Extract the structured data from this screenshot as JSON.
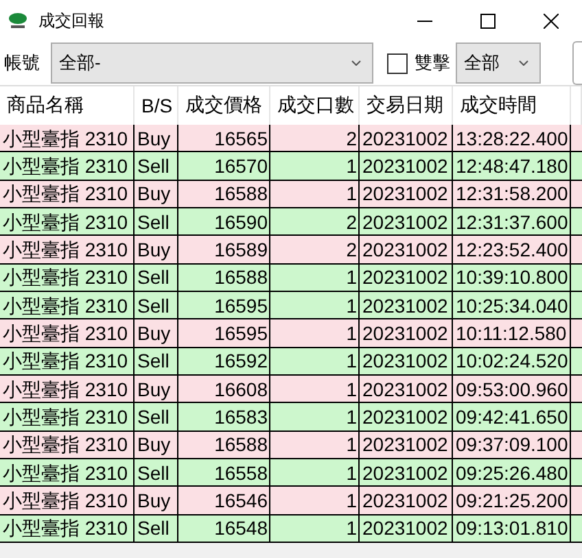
{
  "window": {
    "title": "成交回報"
  },
  "toolbar": {
    "account_label": "帳號",
    "account_value": "全部-",
    "double_click": {
      "label": "雙擊",
      "checked": false
    },
    "filter_value": "全部"
  },
  "table": {
    "columns": [
      "商品名稱",
      "B/S",
      "成交價格",
      "成交口數",
      "交易日期",
      "成交時間"
    ],
    "rows": [
      {
        "kind": "buy",
        "cells": [
          "小型臺指 2310",
          "Buy",
          "16565",
          "2",
          "20231002",
          "13:28:22.400"
        ]
      },
      {
        "kind": "sell",
        "cells": [
          "小型臺指 2310",
          "Sell",
          "16570",
          "1",
          "20231002",
          "12:48:47.180"
        ]
      },
      {
        "kind": "buy",
        "cells": [
          "小型臺指 2310",
          "Buy",
          "16588",
          "1",
          "20231002",
          "12:31:58.200"
        ]
      },
      {
        "kind": "sell",
        "cells": [
          "小型臺指 2310",
          "Sell",
          "16590",
          "2",
          "20231002",
          "12:31:37.600"
        ]
      },
      {
        "kind": "buy",
        "cells": [
          "小型臺指 2310",
          "Buy",
          "16589",
          "2",
          "20231002",
          "12:23:52.400"
        ]
      },
      {
        "kind": "sell",
        "cells": [
          "小型臺指 2310",
          "Sell",
          "16588",
          "1",
          "20231002",
          "10:39:10.800"
        ]
      },
      {
        "kind": "sell",
        "cells": [
          "小型臺指 2310",
          "Sell",
          "16595",
          "1",
          "20231002",
          "10:25:34.040"
        ]
      },
      {
        "kind": "buy",
        "cells": [
          "小型臺指 2310",
          "Buy",
          "16595",
          "1",
          "20231002",
          "10:11:12.580"
        ]
      },
      {
        "kind": "sell",
        "cells": [
          "小型臺指 2310",
          "Sell",
          "16592",
          "1",
          "20231002",
          "10:02:24.520"
        ]
      },
      {
        "kind": "buy",
        "cells": [
          "小型臺指 2310",
          "Buy",
          "16608",
          "1",
          "20231002",
          "09:53:00.960"
        ]
      },
      {
        "kind": "sell",
        "cells": [
          "小型臺指 2310",
          "Sell",
          "16583",
          "1",
          "20231002",
          "09:42:41.650"
        ]
      },
      {
        "kind": "buy",
        "cells": [
          "小型臺指 2310",
          "Buy",
          "16588",
          "1",
          "20231002",
          "09:37:09.100"
        ]
      },
      {
        "kind": "sell",
        "cells": [
          "小型臺指 2310",
          "Sell",
          "16558",
          "1",
          "20231002",
          "09:25:26.480"
        ]
      },
      {
        "kind": "buy",
        "cells": [
          "小型臺指 2310",
          "Buy",
          "16546",
          "1",
          "20231002",
          "09:21:25.200"
        ]
      },
      {
        "kind": "sell",
        "cells": [
          "小型臺指 2310",
          "Sell",
          "16548",
          "1",
          "20231002",
          "09:13:01.810"
        ]
      }
    ]
  }
}
